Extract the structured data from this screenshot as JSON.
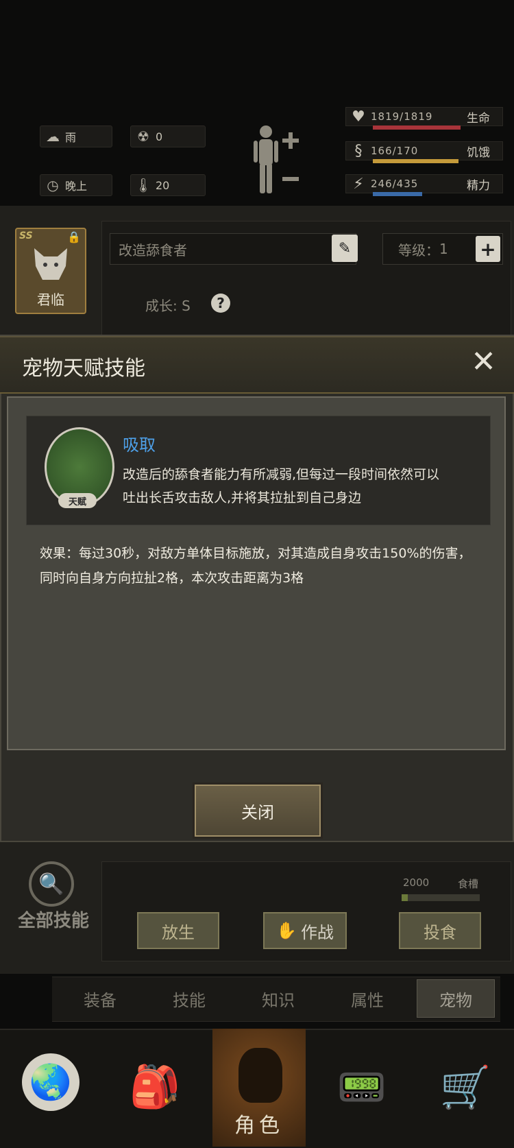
{
  "environment": {
    "weather": "雨",
    "radiation": "0",
    "time_of_day": "晚上",
    "temperature": "20"
  },
  "vitals": [
    {
      "value": "1819/1819",
      "label": "生命",
      "fill": 1.0,
      "color": "#a8343a"
    },
    {
      "value": "166/170",
      "label": "饥饿",
      "fill": 0.976,
      "color": "#c49a3a"
    },
    {
      "value": "246/435",
      "label": "精力",
      "fill": 0.566,
      "color": "#3a6aa8"
    }
  ],
  "pet": {
    "grade_badge": "SS",
    "name_caption": "君临",
    "name_field": "改造舔食者",
    "level_label": "等级",
    "level_value": "1",
    "growth_label": "成长",
    "growth_value": "S"
  },
  "modal": {
    "title": "宠物天赋技能",
    "skill_name": "吸取",
    "skill_badge": "天赋",
    "skill_desc_line1": "改造后的舔食者能力有所减弱,但每过一段时间依然可以",
    "skill_desc_line2": "吐出长舌攻击敌人,并将其拉扯到自己身边",
    "effect_line1": "效果：每过30秒，对敌方单体目标施放，对其造成自身攻击150%的伤害，",
    "effect_line2": "同时向自身方向拉扯2格，本次攻击距离为3格",
    "close_label": "关闭"
  },
  "pet_actions": {
    "all_skills": "全部技能",
    "food_value": "2000",
    "food_label": "食槽",
    "release": "放生",
    "battle": "作战",
    "feed": "投食"
  },
  "tabs": [
    "装备",
    "技能",
    "知识",
    "属性",
    "宠物"
  ],
  "nav": {
    "character": "角色"
  }
}
